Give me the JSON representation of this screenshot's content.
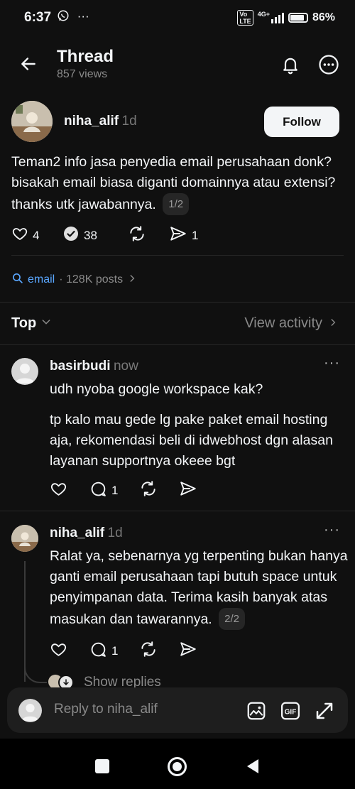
{
  "status_bar": {
    "time": "6:37",
    "left_icons": "ⓦ ⋯",
    "network": "4G+",
    "volte": "Vo LTE",
    "battery": "86%"
  },
  "header": {
    "title": "Thread",
    "views": "857 views",
    "back_icon": "arrow-left-icon",
    "bell_icon": "bell-icon",
    "more_icon": "more-circle-icon"
  },
  "post": {
    "author": "niha_alif",
    "time": "1d",
    "follow_label": "Follow",
    "text": "Teman2 info jasa penyedia email perusahaan donk? bisakah email biasa diganti domainnya atau extensi? thanks utk jawabannya.",
    "pager": "1/2",
    "likes": "4",
    "reposts": "38",
    "shares": "1",
    "topic": "email",
    "topic_posts": "· 128K posts"
  },
  "sort": {
    "label": "Top",
    "view_activity": "View activity"
  },
  "replies": [
    {
      "author": "basirbudi",
      "time": "now",
      "paragraph1": "udh nyoba google workspace kak?",
      "paragraph2": "tp kalo mau gede lg pake paket email hosting aja, rekomendasi beli di idwebhost dgn alasan layanan supportnya okeee bgt",
      "comments": "1"
    },
    {
      "author": "niha_alif",
      "time": "1d",
      "text": "Ralat ya, sebenarnya yg terpenting bukan hanya ganti email perusahaan tapi butuh space untuk penyimpanan data. Terima kasih banyak atas masukan dan tawarannya.",
      "pager": "2/2",
      "comments": "1",
      "show_replies": "Show replies"
    }
  ],
  "composer": {
    "placeholder": "Reply to niha_alif"
  },
  "colors": {
    "background": "#101010",
    "link": "#5aa7ff",
    "muted": "#8a8a8a"
  }
}
